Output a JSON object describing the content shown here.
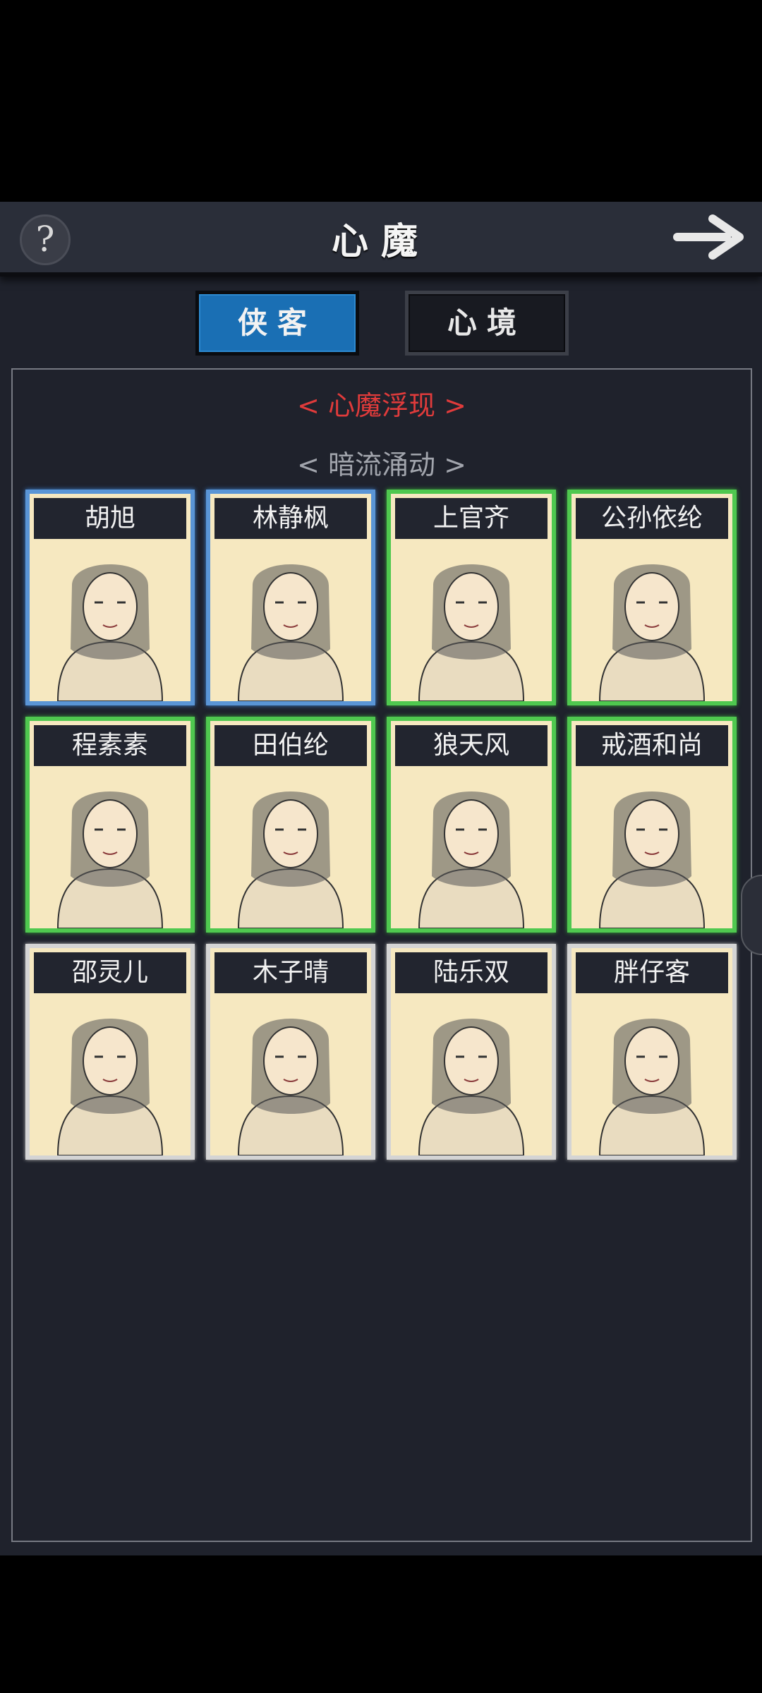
{
  "header": {
    "title": "心魔",
    "help_icon": "?",
    "next_icon": "arrow-right-icon"
  },
  "tabs": [
    {
      "label": "侠客",
      "active": true
    },
    {
      "label": "心境",
      "active": false
    }
  ],
  "sections": {
    "red_heading": "< 心魔浮现 >",
    "gray_heading": "< 暗流涌动 >"
  },
  "characters": [
    {
      "name": "胡旭",
      "frame": "blue"
    },
    {
      "name": "林静枫",
      "frame": "blue"
    },
    {
      "name": "上官齐",
      "frame": "green"
    },
    {
      "name": "公孙依纶",
      "frame": "green"
    },
    {
      "name": "程素素",
      "frame": "green"
    },
    {
      "name": "田伯纶",
      "frame": "green"
    },
    {
      "name": "狼天风",
      "frame": "green"
    },
    {
      "name": "戒酒和尚",
      "frame": "green"
    },
    {
      "name": "邵灵儿",
      "frame": "white"
    },
    {
      "name": "木子晴",
      "frame": "white"
    },
    {
      "name": "陆乐双",
      "frame": "white"
    },
    {
      "name": "胖仔客",
      "frame": "white"
    }
  ]
}
